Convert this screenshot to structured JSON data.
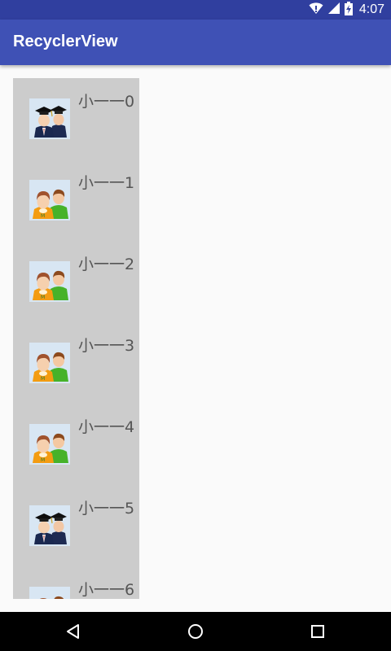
{
  "status_bar": {
    "time": "4:07",
    "icons": [
      "wifi-icon",
      "signal-icon",
      "battery-icon"
    ]
  },
  "app_bar": {
    "title": "RecyclerView"
  },
  "list": {
    "items": [
      {
        "label": "小一一0",
        "icon": "graduates-icon"
      },
      {
        "label": "小一一1",
        "icon": "users-icon"
      },
      {
        "label": "小一一2",
        "icon": "users-icon"
      },
      {
        "label": "小一一3",
        "icon": "users-icon"
      },
      {
        "label": "小一一4",
        "icon": "users-icon"
      },
      {
        "label": "小一一5",
        "icon": "graduates-icon"
      },
      {
        "label": "小一一6",
        "icon": "users-icon"
      }
    ]
  },
  "nav_bar": {
    "buttons": [
      "back-icon",
      "home-icon",
      "recents-icon"
    ]
  },
  "colors": {
    "status_bar": "#303f9f",
    "app_bar": "#3f51b5",
    "list_background": "#cccccc",
    "page_background": "#fafafa"
  }
}
